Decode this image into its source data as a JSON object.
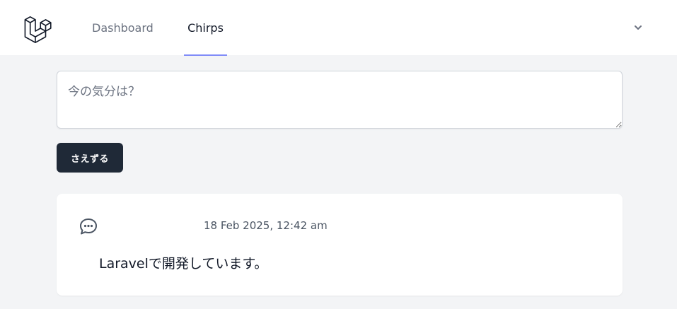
{
  "nav": {
    "logo_icon": "laravel-logo-icon",
    "links": [
      {
        "label": "Dashboard",
        "active": false
      },
      {
        "label": "Chirps",
        "active": true
      }
    ],
    "dropdown_icon": "chevron-down-icon"
  },
  "composer": {
    "placeholder": "今の気分は？",
    "value": ""
  },
  "submit": {
    "label": "さえずる"
  },
  "chirps": [
    {
      "icon": "chat-bubble-icon",
      "timestamp": "18 Feb 2025, 12:42 am",
      "message": "Laravelで開発しています。"
    }
  ],
  "colors": {
    "page_bg": "#f3f4f6",
    "accent_underline": "#818cf8",
    "button_bg": "#1f2937"
  }
}
